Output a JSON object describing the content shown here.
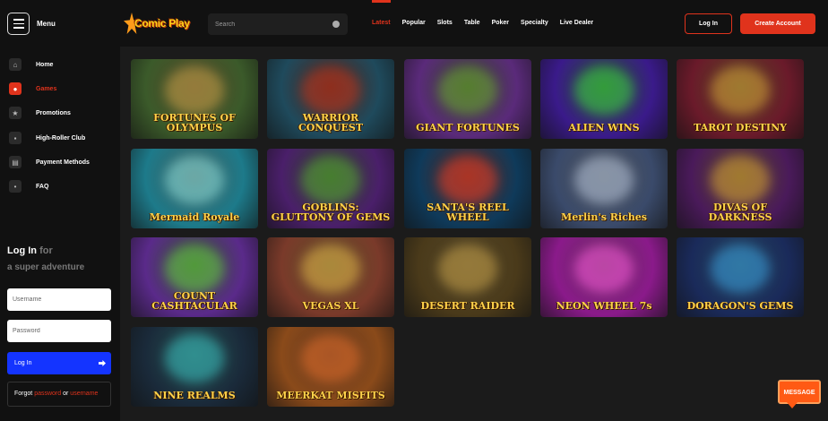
{
  "header": {
    "menu_label": "Menu",
    "logo_text": "Comic Play",
    "search_placeholder": "Search",
    "nav": [
      "Latest",
      "Popular",
      "Slots",
      "Table",
      "Poker",
      "Specialty",
      "Live Dealer"
    ],
    "active_nav": "Latest",
    "login_label": "Log In",
    "create_account_label": "Create Account"
  },
  "sidebar": {
    "items": [
      {
        "label": "Home",
        "icon": "home-icon"
      },
      {
        "label": "Games",
        "icon": "games-icon",
        "active": true
      },
      {
        "label": "Promotions",
        "icon": "star-icon"
      },
      {
        "label": "High-Roller Club",
        "icon": "club-icon"
      },
      {
        "label": "Payment Methods",
        "icon": "wallet-icon"
      },
      {
        "label": "FAQ",
        "icon": "faq-icon"
      }
    ],
    "login": {
      "title": "Log In",
      "title_suffix": "for",
      "subtitle": "a super adventure",
      "username_placeholder": "Username",
      "password_placeholder": "Password",
      "button_label": "Log In",
      "forgot_prefix": "Forgot",
      "forgot_password": "password",
      "forgot_or": "or",
      "forgot_username": "username"
    }
  },
  "games": [
    {
      "title": "FORTUNES OF OLYMPUS",
      "bg": "#3b5a2a",
      "accent": "#c9a449"
    },
    {
      "title": "WARRIOR CONQUEST",
      "bg": "#1f4a5c",
      "accent": "#c0381f"
    },
    {
      "title": "GIANT FORTUNES",
      "bg": "#5a2a7a",
      "accent": "#6fa83a"
    },
    {
      "title": "ALIEN WINS",
      "bg": "#3a1a8a",
      "accent": "#3fd34a"
    },
    {
      "title": "TAROT DESTINY",
      "bg": "#6a1a2a",
      "accent": "#d8a23a"
    },
    {
      "title": "Mermaid Royale",
      "bg": "#1d7a8a",
      "accent": "#8fe4e0"
    },
    {
      "title": "GOBLINS: GLUTTONY OF GEMS",
      "bg": "#4a1f6a",
      "accent": "#5aa83a"
    },
    {
      "title": "SANTA'S REEL WHEEL",
      "bg": "#0f3a5a",
      "accent": "#e8402a"
    },
    {
      "title": "Merlin's Riches",
      "bg": "#3a4a6a",
      "accent": "#b9c8e0"
    },
    {
      "title": "DIVAS OF DARKNESS",
      "bg": "#4a1a5a",
      "accent": "#d9a23a"
    },
    {
      "title": "COUNT CASHTACULAR",
      "bg": "#5a2a8a",
      "accent": "#6ad04a"
    },
    {
      "title": "VEGAS XL",
      "bg": "#7a3a2a",
      "accent": "#e8b84a"
    },
    {
      "title": "DESERT RAIDER",
      "bg": "#4a3a1a",
      "accent": "#c8a24a"
    },
    {
      "title": "NEON WHEEL 7s",
      "bg": "#8a1a8a",
      "accent": "#ff5ae0"
    },
    {
      "title": "DORAGON'S GEMS",
      "bg": "#1a2a5a",
      "accent": "#3aa0e0"
    },
    {
      "title": "NINE REALMS",
      "bg": "#1a2a3a",
      "accent": "#3ac0c0"
    },
    {
      "title": "MEERKAT MISFITS",
      "bg": "#8a4a1a",
      "accent": "#e8702a"
    }
  ],
  "chat": {
    "label": "MESSAGE"
  },
  "colors": {
    "accent": "#e0331c",
    "login_blue": "#1434ff"
  }
}
